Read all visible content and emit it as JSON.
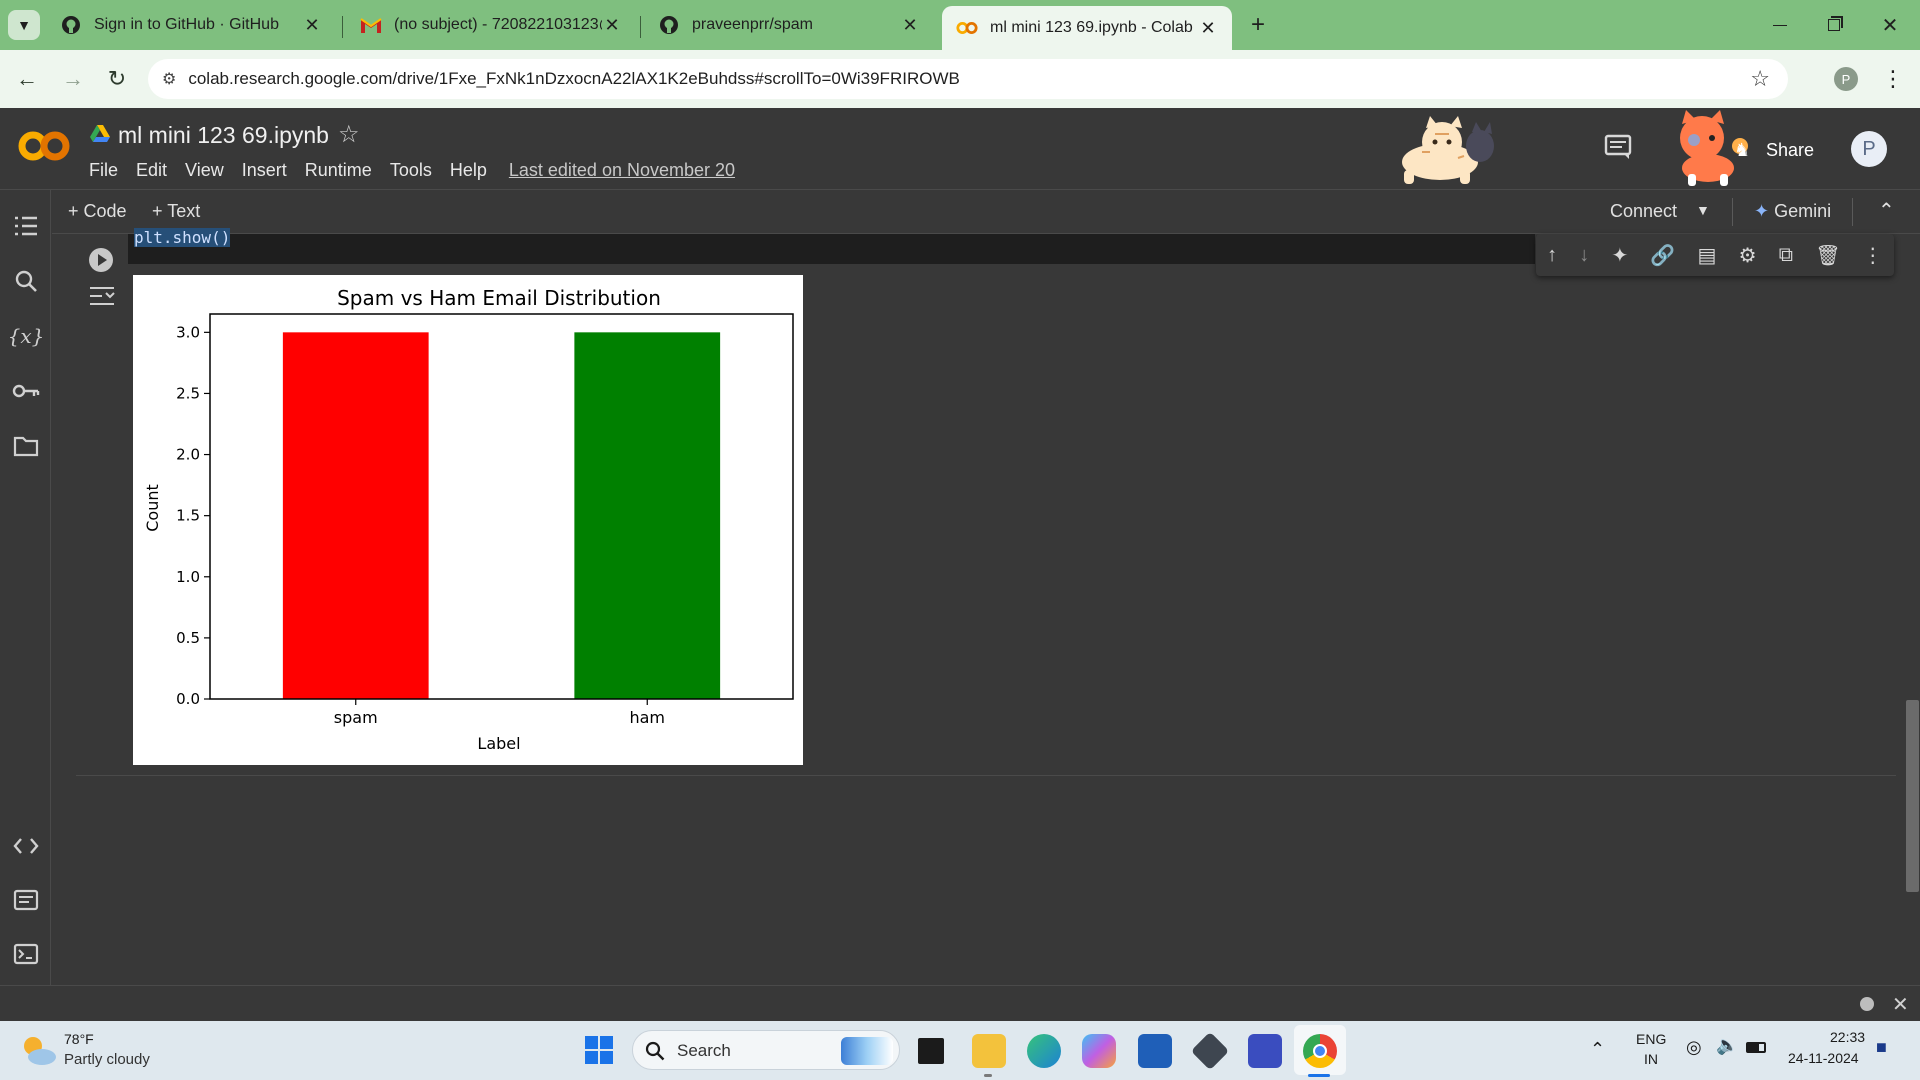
{
  "browser": {
    "tabs": [
      {
        "title": "Sign in to GitHub · GitHub",
        "icon": "github-icon",
        "active": false
      },
      {
        "title": "(no subject) - 720822103123@",
        "icon": "gmail-icon",
        "active": false
      },
      {
        "title": "praveenprr/spam",
        "icon": "github-icon",
        "active": false
      },
      {
        "title": "ml mini 123 69.ipynb - Colab",
        "icon": "colab-icon",
        "active": true
      }
    ],
    "url": "colab.research.google.com/drive/1Fxe_FxNk1nDzxocnA22lAX1K2eBuhdss#scrollTo=0Wi39FRIROWB",
    "profile_initial": "P"
  },
  "colab": {
    "logo": "CO",
    "notebook_title": "ml mini 123 69.ipynb",
    "menu": [
      "File",
      "Edit",
      "View",
      "Insert",
      "Runtime",
      "Tools",
      "Help"
    ],
    "last_edited": "Last edited on November 20",
    "share_label": "Share",
    "avatar_initial": "P",
    "add_code_label": "+ Code",
    "add_text_label": "+ Text",
    "connect_label": "Connect",
    "gemini_label": "Gemini",
    "code_line": "plt.show()"
  },
  "chart_data": {
    "type": "bar",
    "title": "Spam vs Ham Email Distribution",
    "xlabel": "Label",
    "ylabel": "Count",
    "categories": [
      "spam",
      "ham"
    ],
    "values": [
      3,
      3
    ],
    "colors": [
      "#ff0000",
      "#008000"
    ],
    "ylim": [
      0,
      3.15
    ],
    "yticks": [
      "0.0",
      "0.5",
      "1.0",
      "1.5",
      "2.0",
      "2.5",
      "3.0"
    ],
    "ytick_values": [
      0,
      0.5,
      1.0,
      1.5,
      2.0,
      2.5,
      3.0
    ],
    "grid": false
  },
  "taskbar": {
    "weather_temp": "78°F",
    "weather_desc": "Partly cloudy",
    "search_label": "Search",
    "lang_line1": "ENG",
    "lang_line2": "IN",
    "time": "22:33",
    "date": "24-11-2024"
  }
}
